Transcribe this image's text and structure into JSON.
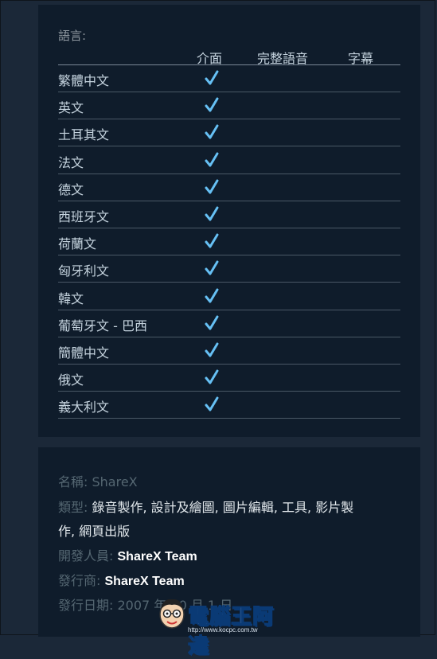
{
  "languages": {
    "title": "語言:",
    "columns": [
      "介面",
      "完整語音",
      "字幕"
    ],
    "rows": [
      {
        "name": "繁體中文",
        "interface": true,
        "audio": false,
        "subtitles": false
      },
      {
        "name": "英文",
        "interface": true,
        "audio": false,
        "subtitles": false
      },
      {
        "name": "土耳其文",
        "interface": true,
        "audio": false,
        "subtitles": false
      },
      {
        "name": "法文",
        "interface": true,
        "audio": false,
        "subtitles": false
      },
      {
        "name": "德文",
        "interface": true,
        "audio": false,
        "subtitles": false
      },
      {
        "name": "西班牙文",
        "interface": true,
        "audio": false,
        "subtitles": false
      },
      {
        "name": "荷蘭文",
        "interface": true,
        "audio": false,
        "subtitles": false
      },
      {
        "name": "匈牙利文",
        "interface": true,
        "audio": false,
        "subtitles": false
      },
      {
        "name": "韓文",
        "interface": true,
        "audio": false,
        "subtitles": false
      },
      {
        "name": "葡萄牙文 - 巴西",
        "interface": true,
        "audio": false,
        "subtitles": false
      },
      {
        "name": "簡體中文",
        "interface": true,
        "audio": false,
        "subtitles": false
      },
      {
        "name": "俄文",
        "interface": true,
        "audio": false,
        "subtitles": false
      },
      {
        "name": "義大利文",
        "interface": true,
        "audio": false,
        "subtitles": false
      }
    ]
  },
  "details": {
    "name_label": "名稱:",
    "name_value": "ShareX",
    "genre_label": "類型:",
    "genres_line1": "錄音製作, 設計及繪圖, 圖片編輯, 工具, 影片製",
    "genres_line2": "作, 網頁出版",
    "developer_label": "開發人員:",
    "developer_value": "ShareX Team",
    "publisher_label": "發行商:",
    "publisher_value": "ShareX Team",
    "release_label": "發行日期:",
    "release_value": "2007 年 10 月 1 日"
  },
  "watermark": {
    "title": "電腦王阿達",
    "url": "http://www.kocpc.com.tw"
  },
  "colors": {
    "page_bg": "#1b2838",
    "panel_bg": "#0f1c2b",
    "check": "#66c0f4",
    "text": "#c6d4df",
    "muted": "#556772"
  }
}
